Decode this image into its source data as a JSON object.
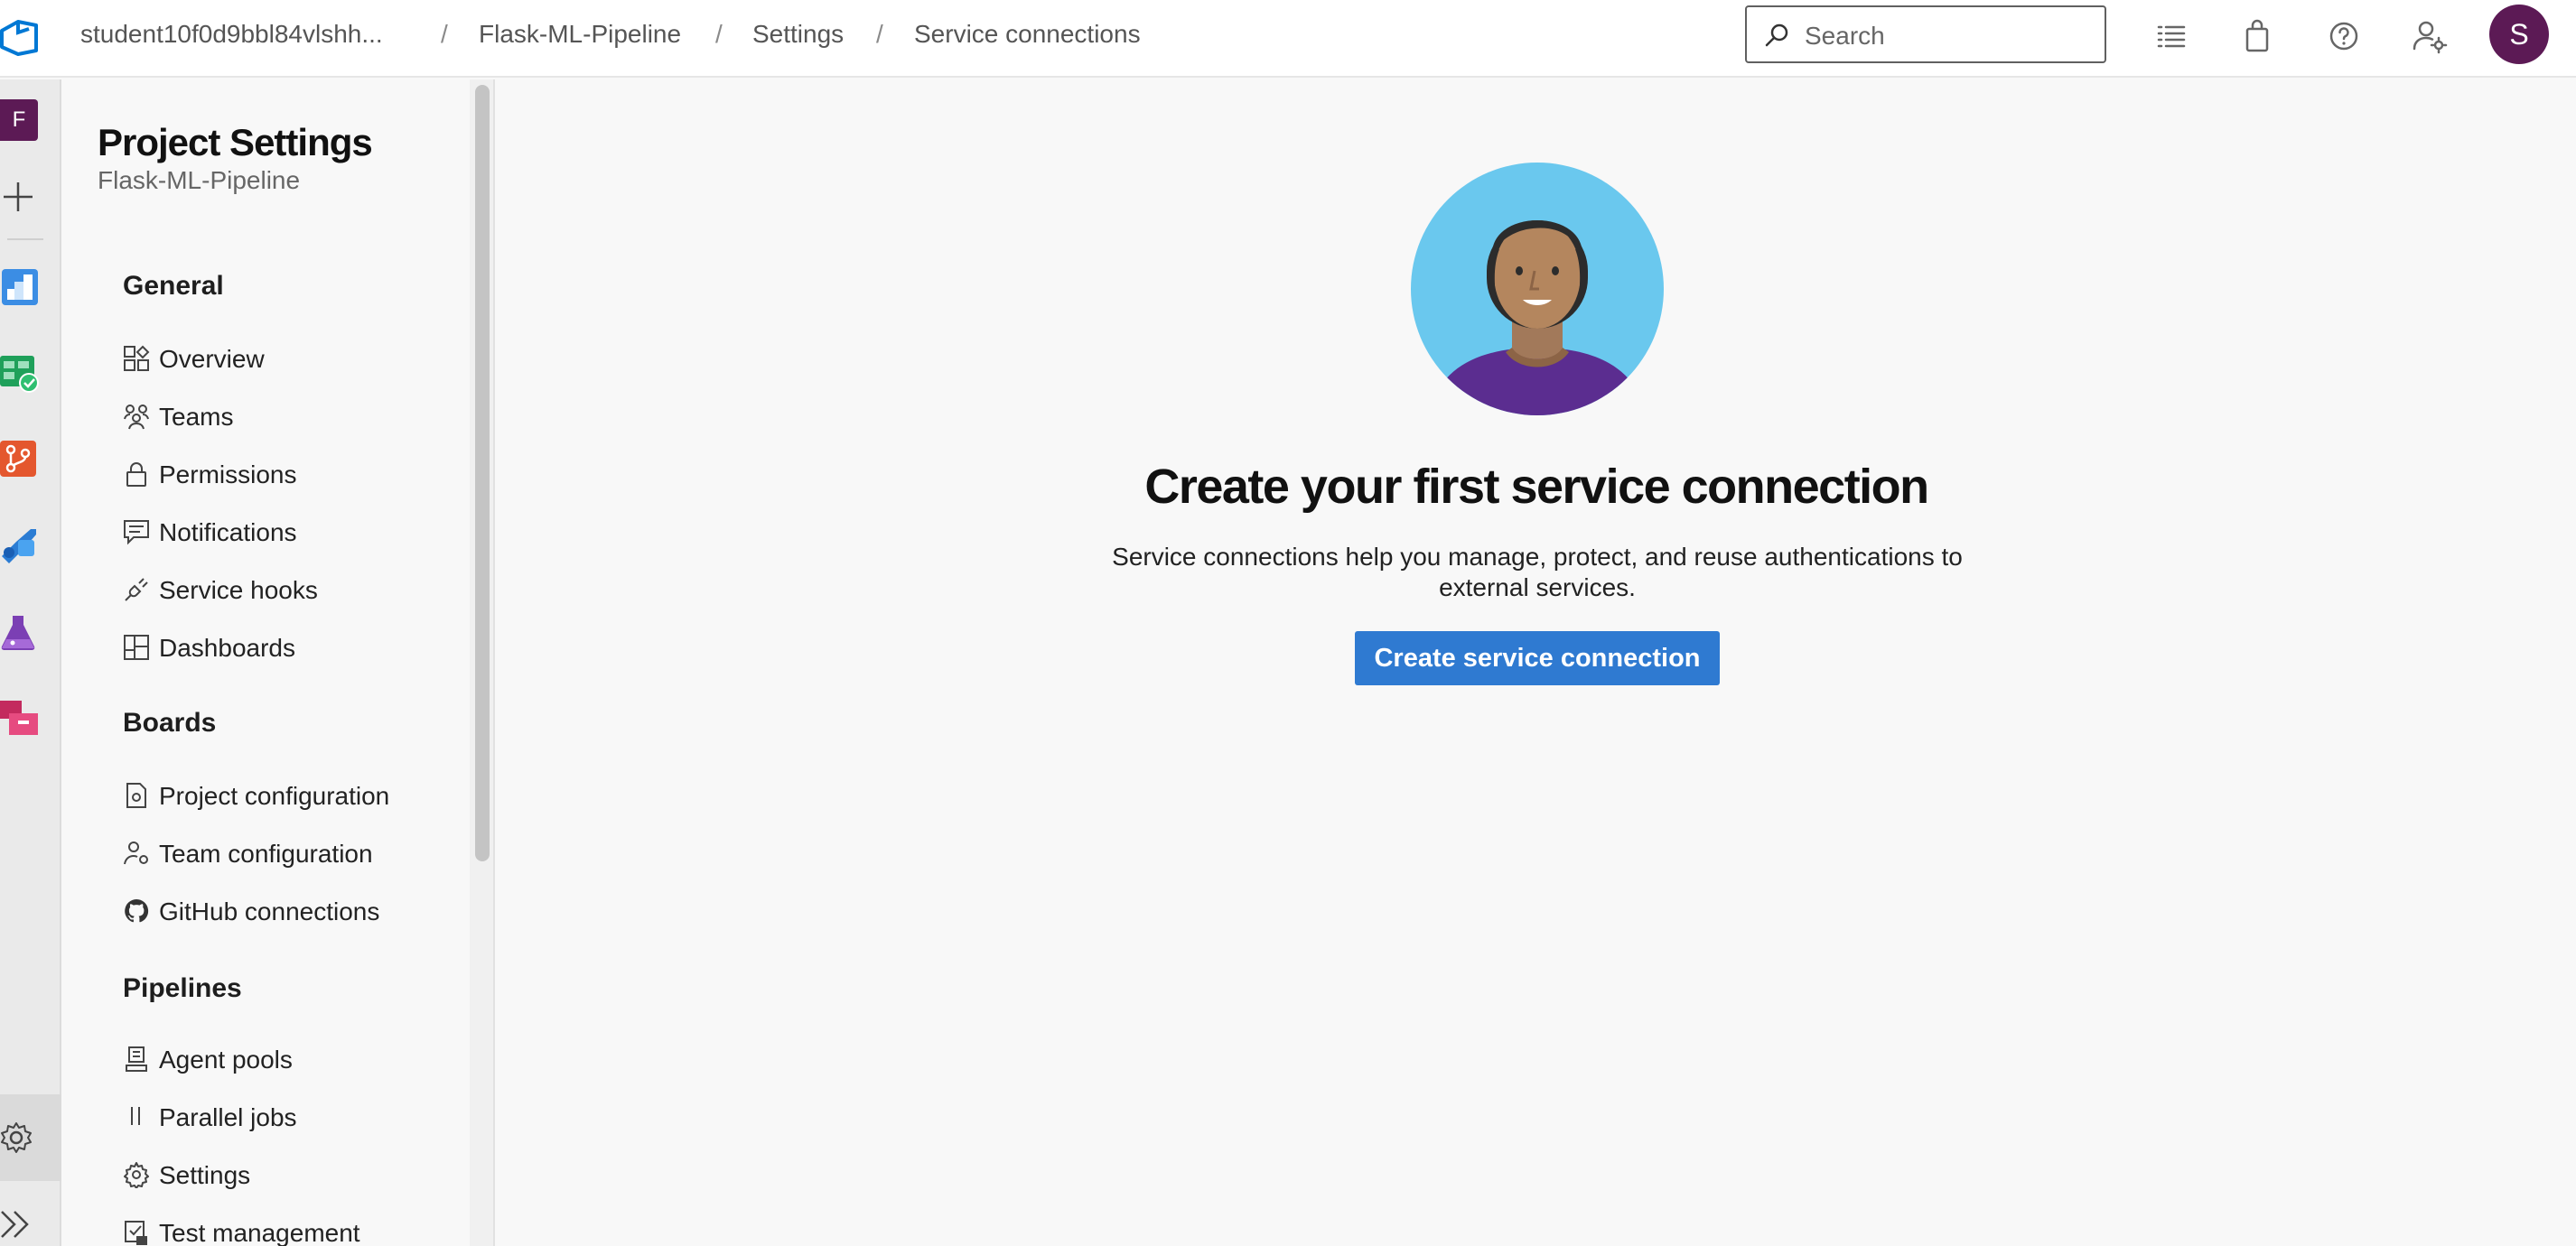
{
  "breadcrumb": {
    "org": "student10f0d9bbl84vlshh...",
    "project": "Flask-ML-Pipeline",
    "settings": "Settings",
    "current": "Service connections",
    "separator": "/"
  },
  "search": {
    "placeholder": "Search"
  },
  "user": {
    "initial": "S"
  },
  "rail": {
    "project_initial": "F"
  },
  "nav": {
    "title": "Project Settings",
    "subtitle": "Flask-ML-Pipeline",
    "groups": {
      "general": "General",
      "boards": "Boards",
      "pipelines": "Pipelines"
    },
    "items": {
      "overview": "Overview",
      "teams": "Teams",
      "permissions": "Permissions",
      "notifications": "Notifications",
      "service_hooks": "Service hooks",
      "dashboards": "Dashboards",
      "project_configuration": "Project configuration",
      "team_configuration": "Team configuration",
      "github_connections": "GitHub connections",
      "agent_pools": "Agent pools",
      "parallel_jobs": "Parallel jobs",
      "settings": "Settings",
      "test_management": "Test management"
    }
  },
  "main": {
    "heading": "Create your first service connection",
    "description": "Service connections help you manage, protect, and reuse authentications to external services.",
    "button": "Create service connection"
  },
  "colors": {
    "accent": "#2f7ad1",
    "avatar": "#5c1a55",
    "illustration_bg": "#6ac8ee",
    "illustration_shirt": "#5b2d90"
  }
}
